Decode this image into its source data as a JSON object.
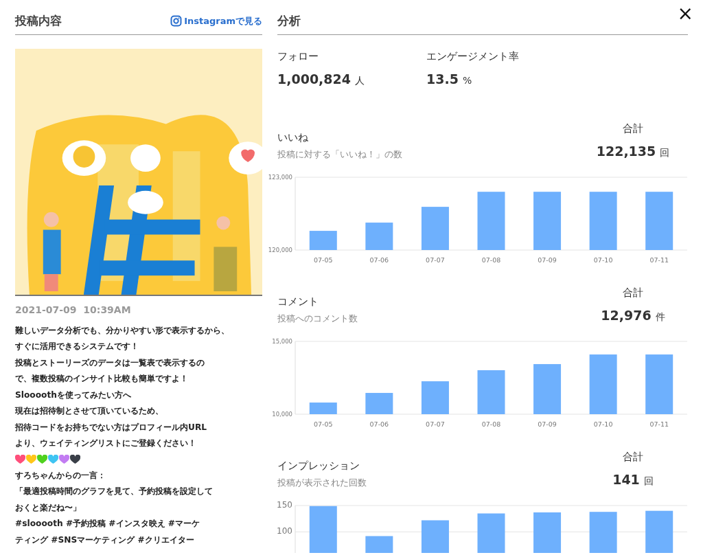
{
  "post": {
    "title": "投稿内容",
    "instagram_link": "Instagramで見る",
    "datetime": "2021-07-09  10:39AM",
    "lines": [
      "難しいデータ分析でも、分かりやすい形で表示するから、",
      "すぐに活用できるシステムです！",
      "投稿とストーリーズのデータは一覧表で表示するの",
      "で、複数投稿のインサイト比較も簡単ですよ！",
      "Sloooothを使ってみたい方へ",
      "現在は招待制とさせて頂いているため、",
      "招待コードをお持ちでない方はプロフィール内URL",
      "より、ウェイティングリストにご登録ください！"
    ],
    "hearts": [
      {
        "color": "#ff4f7b"
      },
      {
        "color": "#ffc61a"
      },
      {
        "color": "#4fd11f"
      },
      {
        "color": "#3fc4f2"
      },
      {
        "color": "#c27cf2"
      },
      {
        "color": "#3a3f48"
      }
    ],
    "lines_after": [
      "すろちゃんからの一言：",
      "「最適投稿時間のグラフを見て、予約投稿を設定して",
      "おくと楽だね〜」",
      "#slooooth #予約投稿 #インスタ映え #マーケ",
      "ティング #SNSマーケティング #クリエイター"
    ]
  },
  "analysis": {
    "title": "分析",
    "close": "×",
    "stats": [
      {
        "label": "フォロー",
        "value": "1,000,824",
        "unit": "人"
      },
      {
        "label": "エンゲージメント率",
        "value": "13.5",
        "unit": "%"
      }
    ],
    "metrics": [
      {
        "title": "いいね",
        "subtitle": "投稿に対する「いいね！」の数",
        "total_label": "合計",
        "total": "122,135",
        "unit": "回",
        "chart_data": {
          "type": "bar",
          "categories": [
            "07-05",
            "07-06",
            "07-07",
            "07-08",
            "07-09",
            "07-10",
            "07-11"
          ],
          "ylim": [
            120000,
            123000
          ],
          "yticks": [
            {
              "value": 120000,
              "label": "120,000"
            },
            {
              "value": 123000,
              "label": "123,000"
            }
          ],
          "series": [
            {
              "color": "#6eb0fd",
              "values": [
                120790,
                121130,
                121780,
                122400,
                122400,
                122400,
                122400
              ]
            }
          ]
        }
      },
      {
        "title": "コメント",
        "subtitle": "投稿へのコメント数",
        "total_label": "合計",
        "total": "12,976",
        "unit": "件",
        "chart_data": {
          "type": "bar",
          "categories": [
            "07-05",
            "07-06",
            "07-07",
            "07-08",
            "07-09",
            "07-10",
            "07-11"
          ],
          "ylim": [
            10000,
            15000
          ],
          "yticks": [
            {
              "value": 10000,
              "label": "10,000"
            },
            {
              "value": 15000,
              "label": "15,000"
            }
          ],
          "series": [
            {
              "color": "#6eb0fd",
              "values": [
                10800,
                11460,
                12260,
                13020,
                13440,
                14100,
                14100
              ]
            }
          ]
        }
      },
      {
        "title": "インプレッション",
        "subtitle": "投稿が表示された回数",
        "total_label": "合計",
        "total": "141",
        "unit": "回",
        "chart_data": {
          "type": "bar",
          "ylim": [
            60,
            150
          ],
          "yticks": [
            100,
            150
          ],
          "series": [
            {
              "color": "#6eb0fd",
              "values": [
                149,
                92,
                122,
                135,
                137,
                138,
                140
              ]
            }
          ]
        }
      }
    ]
  }
}
